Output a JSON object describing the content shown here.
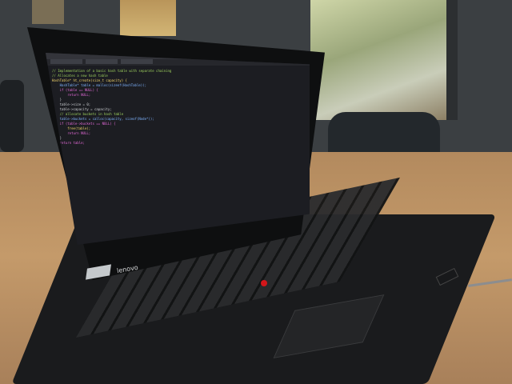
{
  "scene": {
    "description_tag": "",
    "brand_label": "lenovo",
    "colors": {
      "accent": "#d3161a",
      "screen_bg": "#1c1d22"
    }
  },
  "code_lines": [
    "// Implementation of a basic hash table with separate chaining",
    "// Allocates a new hash table",
    "HashTable* ht_create(size_t capacity) {",
    "    HashTable* table = malloc(sizeof(HashTable));",
    "    if (table == NULL) {",
    "        return NULL;",
    "    }",
    "    table->size = 0;",
    "    table->capacity = capacity;",
    "    // allocate buckets in hash table",
    "    table->buckets = calloc(capacity, sizeof(Node*));",
    "    if (table->buckets == NULL) {",
    "        free(table);",
    "        return NULL;",
    "    }",
    "    return table;",
    "}"
  ]
}
